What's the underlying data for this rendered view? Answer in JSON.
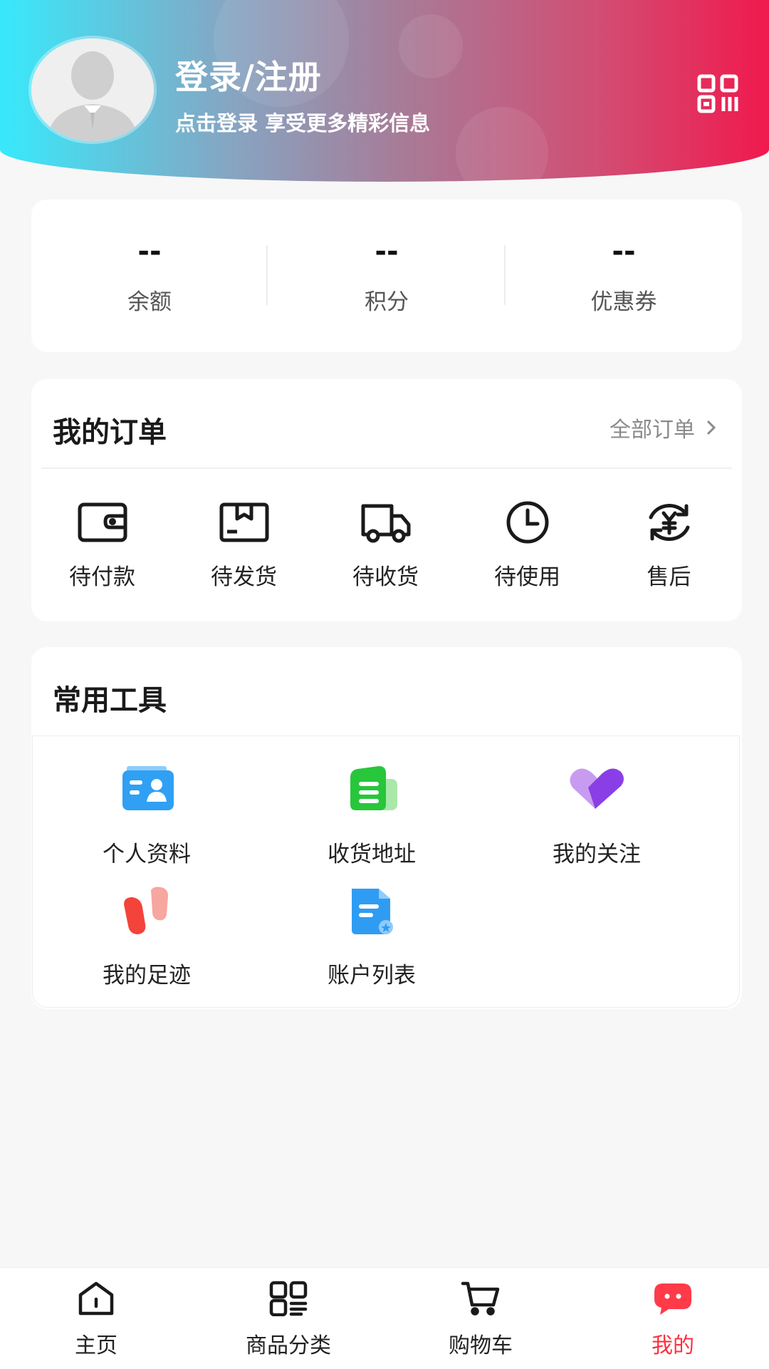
{
  "header": {
    "title": "登录/注册",
    "subtitle": "点击登录 享受更多精彩信息",
    "qr_icon": "qr-code-icon",
    "avatar_icon": "default-avatar-icon"
  },
  "stats": [
    {
      "value": "--",
      "label": "余额"
    },
    {
      "value": "--",
      "label": "积分"
    },
    {
      "value": "--",
      "label": "优惠券"
    }
  ],
  "orders": {
    "title": "我的订单",
    "all_label": "全部订单",
    "items": [
      {
        "label": "待付款",
        "icon": "wallet-icon"
      },
      {
        "label": "待发货",
        "icon": "package-icon"
      },
      {
        "label": "待收货",
        "icon": "truck-icon"
      },
      {
        "label": "待使用",
        "icon": "clock-icon"
      },
      {
        "label": "售后",
        "icon": "refund-yuan-icon"
      }
    ]
  },
  "tools": {
    "title": "常用工具",
    "items": [
      {
        "label": "个人资料",
        "icon": "profile-card-icon"
      },
      {
        "label": "收货地址",
        "icon": "address-icon"
      },
      {
        "label": "我的关注",
        "icon": "heart-icon"
      },
      {
        "label": "我的足迹",
        "icon": "footprint-icon"
      },
      {
        "label": "账户列表",
        "icon": "account-list-icon"
      }
    ]
  },
  "nav": {
    "items": [
      {
        "label": "主页",
        "icon": "home-icon"
      },
      {
        "label": "商品分类",
        "icon": "category-icon"
      },
      {
        "label": "购物车",
        "icon": "cart-icon"
      },
      {
        "label": "我的",
        "icon": "my-chat-icon"
      }
    ],
    "active_color": "#ff3040"
  },
  "colors": {
    "gradient_start": "#38e9fb",
    "gradient_end": "#f0194d",
    "page_bg": "#f7f7f7"
  }
}
